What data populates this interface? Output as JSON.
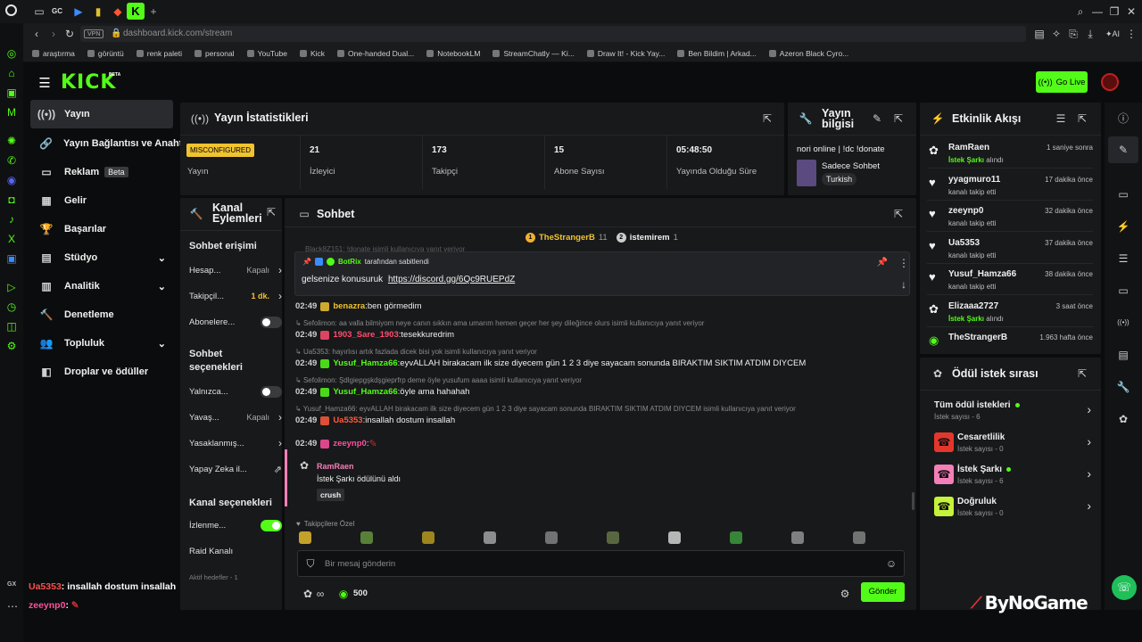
{
  "browser": {
    "tabs": [
      "GC"
    ],
    "url": "dashboard.kick.com/stream",
    "vpn": "VPN",
    "bookmarks": [
      "araştırma",
      "görüntü",
      "renk paleti",
      "personal",
      "YouTube",
      "Kick",
      "One-handed Dual...",
      "NotebookLM",
      "StreamChatly — Ki...",
      "Draw It! - Kick Yay...",
      "Ben Bildim | Arkad...",
      "Azeron Black Cyro..."
    ]
  },
  "header": {
    "logo": "KICK",
    "beta": "BETA",
    "go_live": "Go Live"
  },
  "sidebar": {
    "items": [
      "Yayın",
      "Yayın Bağlantısı ve Anahtarı",
      "Reklam",
      "Gelir",
      "Başarılar",
      "Stüdyo",
      "Analitik",
      "Denetleme",
      "Topluluk",
      "Droplar ve ödüller"
    ],
    "beta_badge": "Beta"
  },
  "stats": {
    "title": "Yayın İstatistikleri",
    "status_badge": "MISCONFIGURED",
    "status_label": "Yayın",
    "cells": [
      {
        "value": "21",
        "label": "İzleyici"
      },
      {
        "value": "173",
        "label": "Takipçi"
      },
      {
        "value": "15",
        "label": "Abone Sayısı"
      },
      {
        "value": "05:48:50",
        "label": "Yayında Olduğu Süre"
      }
    ]
  },
  "stream_info": {
    "title": "Yayın bilgisi",
    "stream_title": "nori online | !dc !donate",
    "category": "Sadece Sohbet",
    "language": "Turkish"
  },
  "channel_actions": {
    "title": "Kanal Eylemleri",
    "chat_access": "Sohbet erişimi",
    "rows1": [
      {
        "label": "Hesap...",
        "value": "Kapalı"
      },
      {
        "label": "Takipçil...",
        "value": "1 dk."
      },
      {
        "label": "Abonelere...",
        "value": ""
      }
    ],
    "chat_options": "Sohbet seçenekleri",
    "rows2": [
      {
        "label": "Yalnızca...",
        "value": ""
      },
      {
        "label": "Yavaş...",
        "value": "Kapalı"
      },
      {
        "label": "Yasaklanmış...",
        "value": ""
      },
      {
        "label": "Yapay Zeka il...",
        "value": ""
      }
    ],
    "channel_options": "Kanal seçenekleri",
    "rows3": [
      {
        "label": "İzlenme...",
        "value": ""
      },
      {
        "label": "Raid Kanalı",
        "value": ""
      },
      {
        "label": "Aktif hedefler - 1",
        "value": ""
      }
    ]
  },
  "chat": {
    "title": "Sohbet",
    "top_gifters": [
      {
        "rank": "1",
        "name": "TheStrangerB",
        "count": "11"
      },
      {
        "rank": "2",
        "name": "istemirem",
        "count": "1"
      }
    ],
    "clipped_line": "Black8Z151: !donate isimli kullanıcıya yanıt veriyor",
    "pinned": {
      "by": "BotRix",
      "by_suffix": "tarafından sabitlendi",
      "text": "gelsenize konusuruk",
      "link": "https://discord.gg/6Qc9RUEPdZ"
    },
    "messages": [
      {
        "reply": "",
        "time": "02:49",
        "user": "benazra",
        "color": "#f0c330",
        "text": "ben görmedim"
      },
      {
        "reply": "Sefolimon: aa valla bilmiyom neye canın sıkkın ama umarım hemen geçer her şey dileğince olurs isimli kullanıcıya yanıt veriyor",
        "time": "02:49",
        "user": "1903_Sare_1903",
        "color": "#ff4d6d",
        "text": "tesekkuredrim"
      },
      {
        "reply": "Ua5353: hayırlısı artık fazlada dicek bisi yok isimli kullanıcıya yanıt veriyor",
        "time": "02:49",
        "user": "Yusuf_Hamza66",
        "color": "#53fc18",
        "text": "eyvALLAH birakacam ilk size diyecem gün 1 2 3 diye sayacam sonunda BIRAKTIM SIKTIM ATDIM DIYCEM"
      },
      {
        "reply": "Sefolimon: Şdlgiepgşkdşgieprfrp deme öyle yusufum aaaa isimli kullanıcıya yanıt veriyor",
        "time": "02:49",
        "user": "Yusuf_Hamza66",
        "color": "#53fc18",
        "text": "öyle ama hahahah"
      },
      {
        "reply": "Yusuf_Hamza66: eyvALLAH birakacam ilk size diyecem gün 1 2 3 diye sayacam sonunda BIRAKTIM SIKTIM ATDIM DIYCEM isimli kullanıcıya yanıt veriyor",
        "time": "02:49",
        "user": "Ua5353",
        "color": "#ff5a3c",
        "text": "insallah dostum insallah"
      },
      {
        "reply": "",
        "time": "02:49",
        "user": "zeeynp0",
        "color": "#ff4fa0",
        "text": ""
      }
    ],
    "reward": {
      "user": "RamRaen",
      "text": "İstek Şarkı ödülünü aldı",
      "tag": "crush"
    },
    "emote_bar_label": "Takipçilere Özel",
    "input_placeholder": "Bir mesaj gönderin",
    "points": "500",
    "send": "Gönder"
  },
  "activity": {
    "title": "Etkinlik Akışı",
    "items": [
      {
        "name": "RamRaen",
        "sub_hl": "İstek Şarkı",
        "sub": "alındı",
        "time": "1 saniye sonra",
        "icon": "reward"
      },
      {
        "name": "yyagmuro11",
        "sub_hl": "",
        "sub": "kanalı takip etti",
        "time": "17 dakika önce",
        "icon": "heart"
      },
      {
        "name": "zeeynp0",
        "sub_hl": "",
        "sub": "kanalı takip etti",
        "time": "32 dakika önce",
        "icon": "heart"
      },
      {
        "name": "Ua5353",
        "sub_hl": "",
        "sub": "kanalı takip etti",
        "time": "37 dakika önce",
        "icon": "heart"
      },
      {
        "name": "Yusuf_Hamza66",
        "sub_hl": "",
        "sub": "kanalı takip etti",
        "time": "38 dakika önce",
        "icon": "heart"
      },
      {
        "name": "Elizaaa2727",
        "sub_hl": "İstek Şarkı",
        "sub": "alındı",
        "time": "3 saat önce",
        "icon": "reward"
      },
      {
        "name": "TheStrangerB",
        "sub_hl": "",
        "sub": "",
        "time": "1.963 hafta önce",
        "icon": "kick"
      }
    ]
  },
  "rewards": {
    "title": "Ödül istek sırası",
    "items": [
      {
        "name": "Tüm ödül istekleri",
        "count": "İstek sayısı - 6",
        "dot": true,
        "color": ""
      },
      {
        "name": "Cesaretlilik",
        "count": "İstek sayısı - 0",
        "dot": false,
        "color": "#e5362c"
      },
      {
        "name": "İstek Şarkı",
        "count": "İstek sayısı - 6",
        "dot": true,
        "color": "#f37fb8"
      },
      {
        "name": "Doğruluk",
        "count": "İstek sayısı - 0",
        "dot": false,
        "color": "#c5f23a"
      }
    ]
  },
  "overlay": {
    "gx_label": "GX",
    "lines": [
      {
        "user": "Ua5353",
        "text": ": insallah dostum insallah",
        "color": "#ff4d4d"
      },
      {
        "user": "zeeynp0",
        "text": ":",
        "color": "#ff4fa0"
      }
    ],
    "watermark": "ByNoGame"
  },
  "colors": {
    "kick_green": "#53fc18",
    "panel": "#18191b",
    "background": "#0b0c0d"
  }
}
